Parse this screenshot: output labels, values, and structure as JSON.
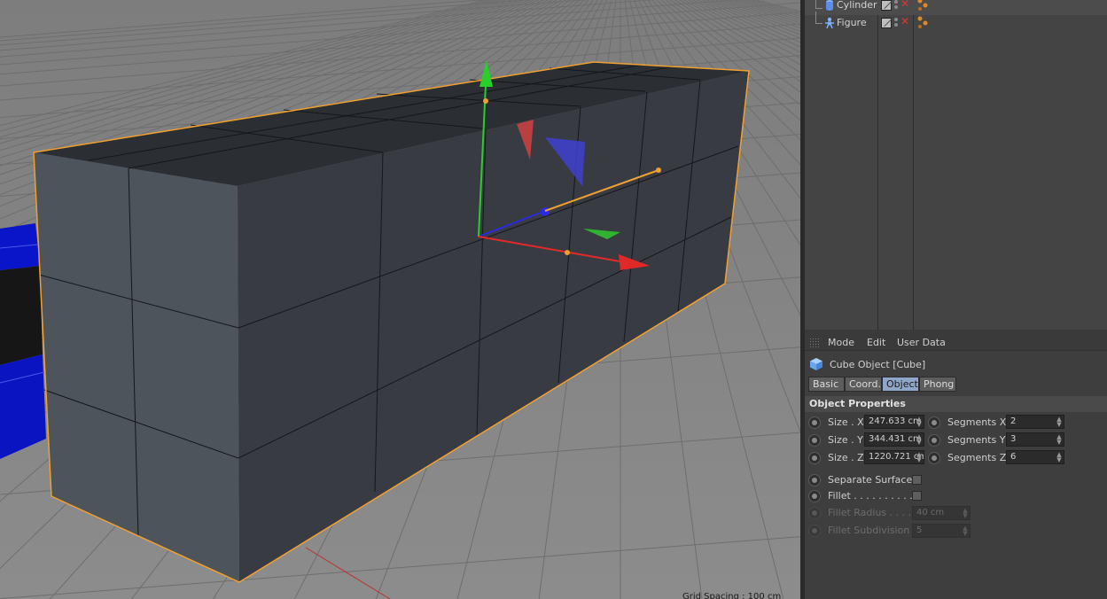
{
  "viewport": {
    "grid_spacing_label": "Grid Spacing : 100 cm"
  },
  "object_manager": {
    "objects": [
      {
        "name": "Cylinder",
        "icon": "cylinder-icon"
      },
      {
        "name": "Figure",
        "icon": "figure-icon"
      }
    ]
  },
  "attribute_manager": {
    "menu": [
      "Mode",
      "Edit",
      "User Data"
    ],
    "title": "Cube Object [Cube]",
    "tabs": [
      "Basic",
      "Coord.",
      "Object",
      "Phong"
    ],
    "active_tab": "Object",
    "section": "Object Properties",
    "size": {
      "x_label": "Size . X",
      "x_value": "247.633 cm",
      "y_label": "Size . Y",
      "y_value": "344.431 cm",
      "z_label": "Size . Z",
      "z_value": "1220.721 cm"
    },
    "segments": {
      "x_label": "Segments X",
      "x_value": "2",
      "y_label": "Segments Y",
      "y_value": "3",
      "z_label": "Segments Z",
      "z_value": "6"
    },
    "separate_surfaces_label": "Separate Surfaces",
    "fillet_label": "Fillet . . . . . . . . . .",
    "fillet_radius_label": "Fillet Radius . . . .",
    "fillet_radius_value": "40 cm",
    "fillet_subdivision_label": "Fillet Subdivision",
    "fillet_subdivision_value": "5"
  },
  "colors": {
    "selection_outline": "#f0a030",
    "axis_x": "#e02a2a",
    "axis_y": "#2ad02a",
    "axis_z": "#2a2ae0",
    "active_tab": "#8fa6c8"
  }
}
